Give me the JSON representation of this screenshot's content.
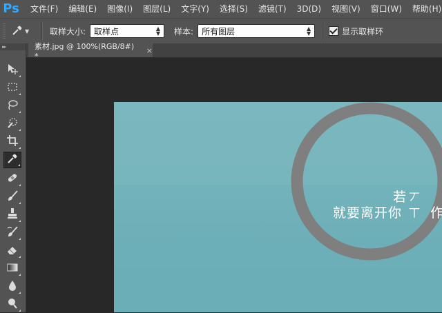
{
  "app": {
    "logo": "Ps"
  },
  "menu": [
    "文件(F)",
    "编辑(E)",
    "图像(I)",
    "图层(L)",
    "文字(Y)",
    "选择(S)",
    "滤镜(T)",
    "3D(D)",
    "视图(V)",
    "窗口(W)",
    "帮助(H)"
  ],
  "options": {
    "tool_icon": "eyedropper-icon",
    "sample_size_label": "取样大小:",
    "sample_size_value": "取样点",
    "sample_label": "样本:",
    "sample_value": "所有图层",
    "show_ring_label": "显示取样环",
    "show_ring_checked": true
  },
  "toolbar": {
    "header": "▸▸",
    "tools": [
      {
        "name": "move-tool",
        "icon": "move-icon"
      },
      {
        "name": "marquee-tool",
        "icon": "rect-marquee-icon"
      },
      {
        "name": "lasso-tool",
        "icon": "lasso-icon"
      },
      {
        "name": "quick-select-tool",
        "icon": "quick-select-icon"
      },
      {
        "name": "crop-tool",
        "icon": "crop-icon"
      },
      {
        "name": "eyedropper-tool",
        "icon": "eyedropper-icon",
        "active": true
      },
      {
        "name": "healing-brush-tool",
        "icon": "bandage-icon"
      },
      {
        "name": "brush-tool",
        "icon": "brush-icon"
      },
      {
        "name": "clone-stamp-tool",
        "icon": "stamp-icon"
      },
      {
        "name": "history-brush-tool",
        "icon": "history-brush-icon"
      },
      {
        "name": "eraser-tool",
        "icon": "eraser-icon"
      },
      {
        "name": "gradient-tool",
        "icon": "gradient-icon"
      },
      {
        "name": "blur-tool",
        "icon": "drop-icon"
      },
      {
        "name": "dodge-tool",
        "icon": "dodge-icon"
      }
    ]
  },
  "document": {
    "tab_title": "素材.jpg @ 100%(RGB/8#) *",
    "close_glyph": "×"
  },
  "canvas": {
    "line1": "若",
    "line1_fragment_right": "丆",
    "line2": "就要离开你",
    "line2_fragment_right": "作",
    "line2_fragment": "丅",
    "colors": {
      "sky": "#7ab7bf",
      "ring": "#808080",
      "text": "#ffffff"
    }
  }
}
